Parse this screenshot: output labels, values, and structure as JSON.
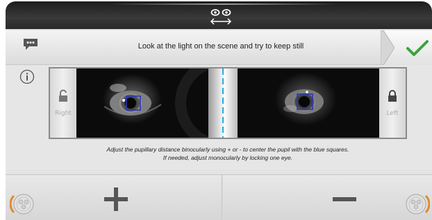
{
  "header": {
    "icon": "eyes-distance-icon"
  },
  "instruction": {
    "icon": "speech-bubble-icon",
    "text": "Look at the light on the scene and try to keep still",
    "confirm_icon": "check-icon",
    "accent": "#3aa33a"
  },
  "camera": {
    "info_icon": "info-icon",
    "right_lock": {
      "label": "Right",
      "state": "unlocked",
      "icon": "lock-open-icon"
    },
    "left_lock": {
      "label": "Left",
      "state": "locked",
      "icon": "lock-closed-icon"
    },
    "target_color": "#2a35b8",
    "center_line_color": "#23a9e0"
  },
  "help": {
    "line1": "Adjust the pupillary distance binocularly using + or - to center the pupil with the blue squares.",
    "line2": "If needed, adjust monocularly by locking one eye."
  },
  "controls": {
    "plus_icon": "plus-icon",
    "minus_icon": "minus-icon",
    "knob_icon": "knob-icon",
    "knob_accent": "#e08a2a"
  }
}
